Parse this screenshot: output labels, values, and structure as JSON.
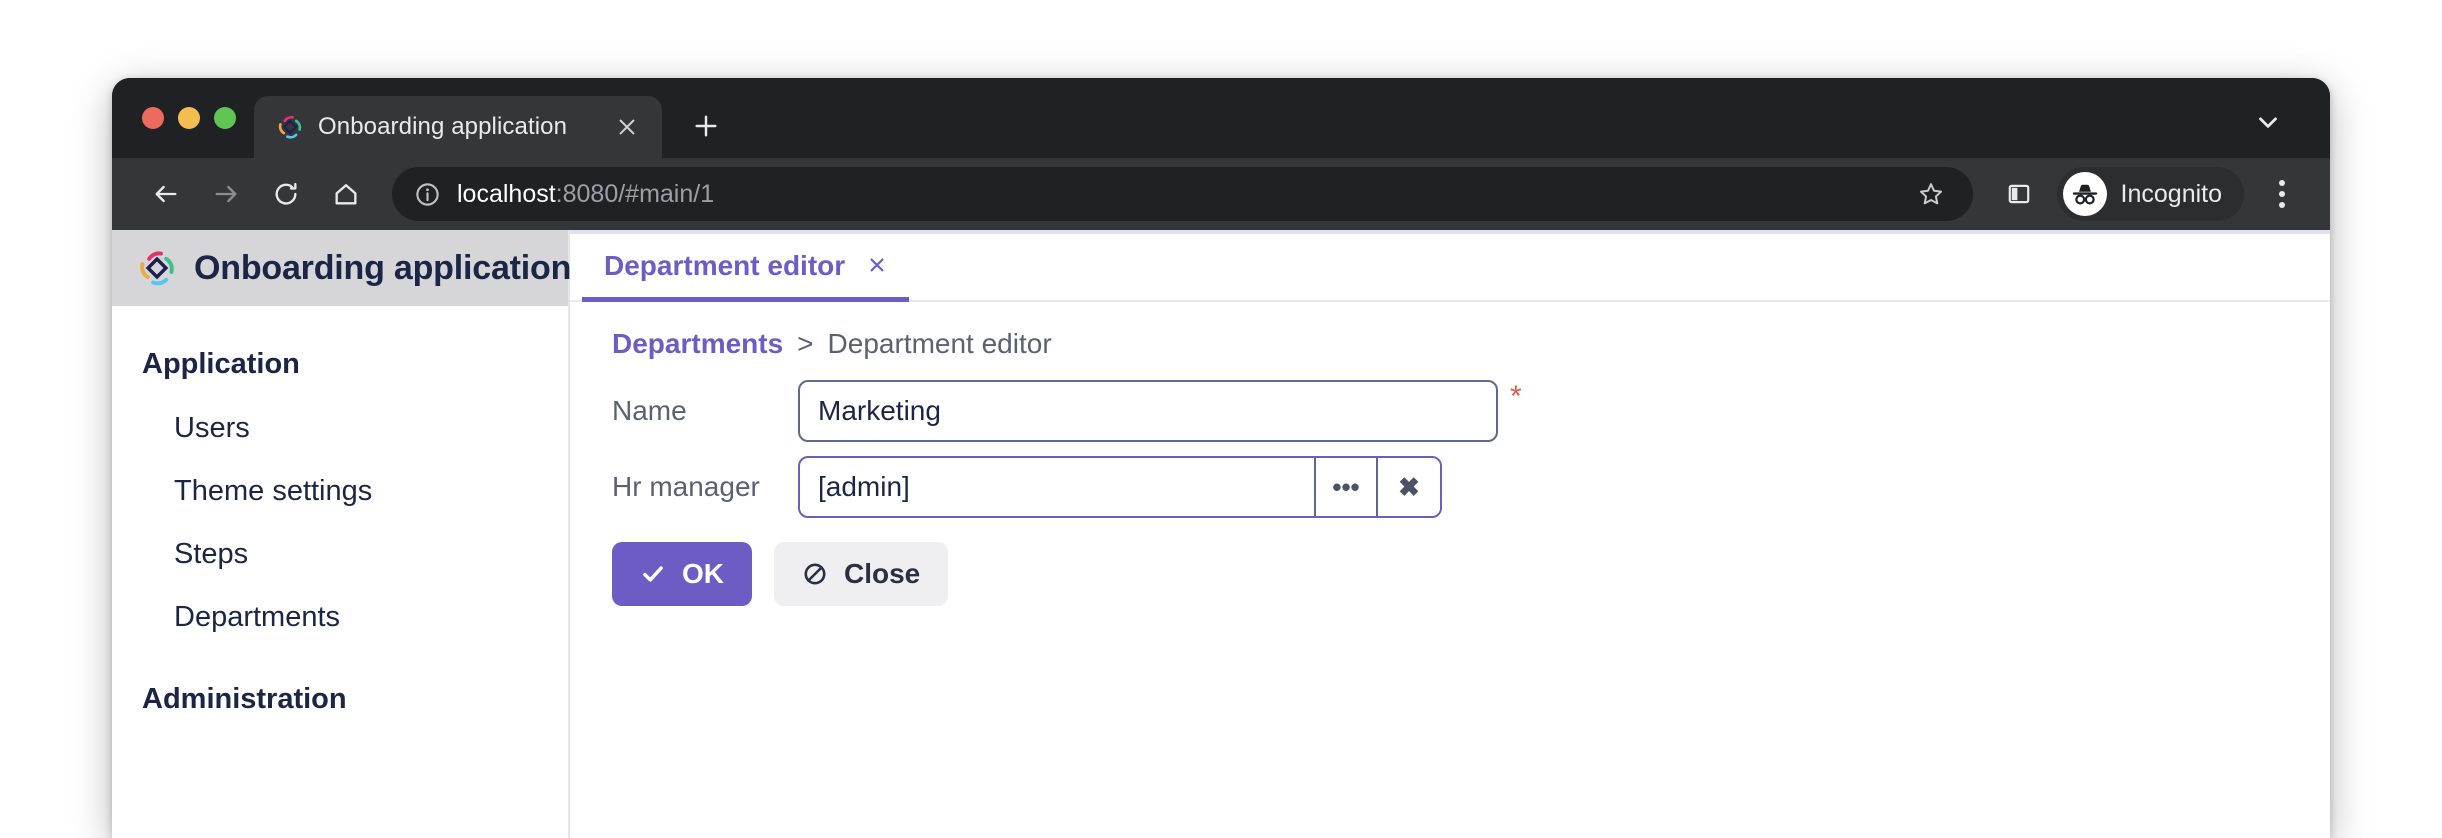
{
  "browser": {
    "tab": {
      "title": "Onboarding application",
      "favicon_icon": "diamond-logo-icon",
      "close_icon": "close-icon"
    },
    "newtab_icon": "plus-icon",
    "window_chevron_icon": "chevron-down-icon",
    "traffic_lights": [
      "close-red",
      "minimize-yellow",
      "zoom-green"
    ],
    "toolbar": {
      "back_icon": "arrow-left-icon",
      "forward_icon": "arrow-right-icon",
      "reload_icon": "reload-icon",
      "home_icon": "home-icon",
      "info_icon": "circle-info-icon",
      "url_host": "localhost",
      "url_rest": ":8080/#main/1",
      "bookmark_icon": "star-icon",
      "side_panel_icon": "side-panel-icon",
      "profile_label": "Incognito",
      "profile_icon": "incognito-icon",
      "menu_icon": "kebab-menu-icon"
    }
  },
  "sidebar": {
    "brand": "Onboarding application",
    "brand_logo_icon": "diamond-logo-icon",
    "groups": [
      {
        "label": "Application",
        "items": [
          "Users",
          "Theme settings",
          "Steps",
          "Departments"
        ]
      },
      {
        "label": "Administration",
        "items": []
      }
    ]
  },
  "content": {
    "tabs": [
      {
        "label": "Department editor",
        "close_icon": "close-icon",
        "active": true
      }
    ],
    "breadcrumb": {
      "link": "Departments",
      "separator": ">",
      "current": "Department editor"
    },
    "form": {
      "fields": [
        {
          "label": "Name",
          "value": "Marketing",
          "placeholder": "",
          "required": true,
          "required_marker": "*",
          "focused": false
        },
        {
          "label": "Hr manager",
          "value": "[admin]",
          "placeholder": "",
          "required": false,
          "focused": true,
          "lookup_label": "•••",
          "clear_label": "✖"
        }
      ],
      "buttons": {
        "ok_label": "OK",
        "ok_icon": "check-icon",
        "close_label": "Close",
        "close_icon": "ban-icon"
      }
    }
  },
  "colors": {
    "accent": "#6C5CC4",
    "brand_navy": "#1B2545",
    "label_gray": "#5A6172",
    "required_red": "#E05C4B",
    "browser_dark": "#202124",
    "toolbar_dark": "#35363A",
    "sidebar_header": "#D6D6D8"
  }
}
